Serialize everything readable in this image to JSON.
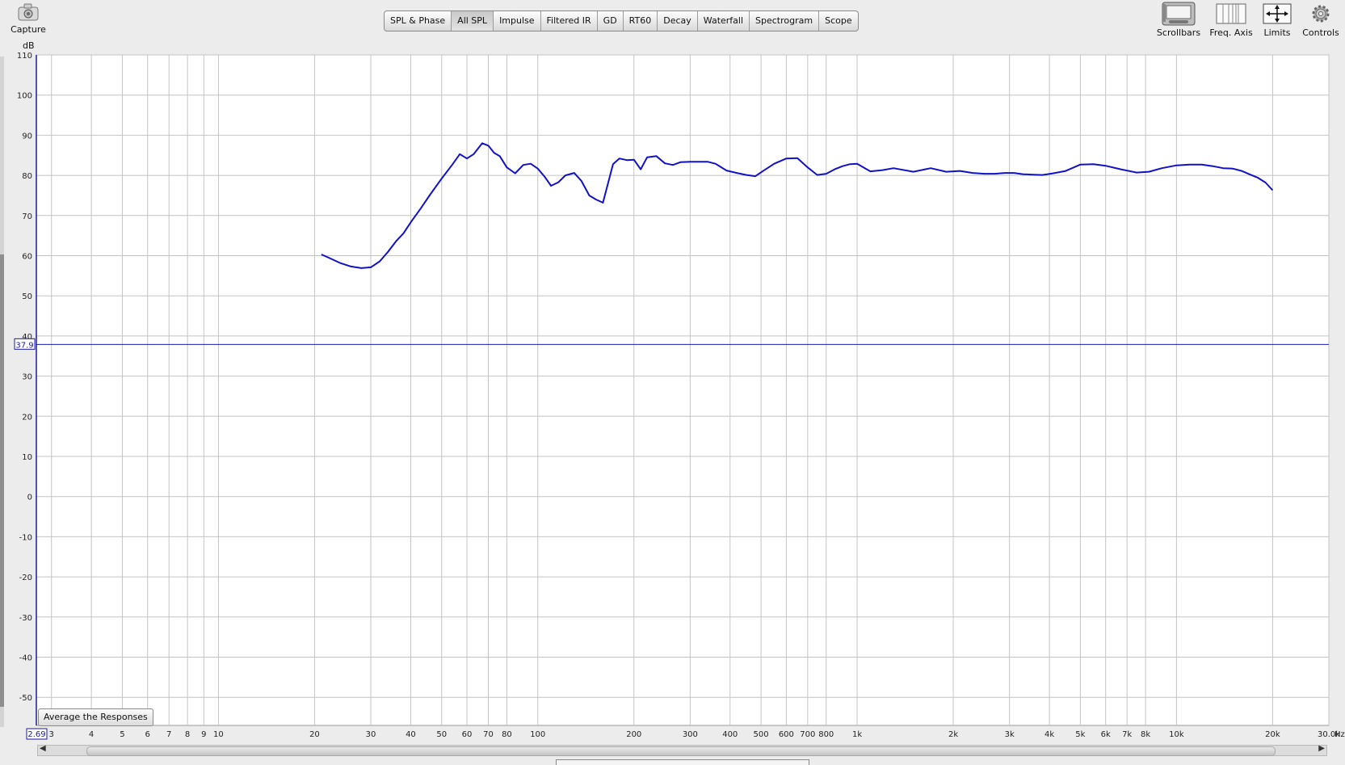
{
  "toolbar": {
    "capture_label": "Capture",
    "scrollbars_label": "Scrollbars",
    "freq_axis_label": "Freq. Axis",
    "limits_label": "Limits",
    "controls_label": "Controls"
  },
  "tabs": [
    {
      "label": "SPL & Phase",
      "active": false
    },
    {
      "label": "All SPL",
      "active": true
    },
    {
      "label": "Impulse",
      "active": false
    },
    {
      "label": "Filtered IR",
      "active": false
    },
    {
      "label": "GD",
      "active": false
    },
    {
      "label": "RT60",
      "active": false
    },
    {
      "label": "Decay",
      "active": false
    },
    {
      "label": "Waterfall",
      "active": false
    },
    {
      "label": "Spectrogram",
      "active": false
    },
    {
      "label": "Scope",
      "active": false
    }
  ],
  "y_unit": "dB",
  "x_unit": "Hz",
  "average_button_label": "Average the Responses",
  "colors": {
    "trace": "#1111c8",
    "cursor": "#1a1aa8",
    "grid": "#c4c4c4",
    "plot_bg": "#ffffff"
  },
  "chart_data": {
    "type": "line",
    "y_unit_label": "dB",
    "x_unit_label": "Hz",
    "xscale": "log",
    "xlim": [
      2.69,
      30000
    ],
    "ylim": [
      -57,
      110
    ],
    "grid": true,
    "y_ticks": [
      110,
      100,
      90,
      80,
      70,
      60,
      50,
      40,
      30,
      20,
      10,
      0,
      -10,
      -20,
      -30,
      -40,
      -50
    ],
    "x_ticks": [
      {
        "value": 3,
        "label": "3"
      },
      {
        "value": 4,
        "label": "4"
      },
      {
        "value": 5,
        "label": "5"
      },
      {
        "value": 6,
        "label": "6"
      },
      {
        "value": 7,
        "label": "7"
      },
      {
        "value": 8,
        "label": "8"
      },
      {
        "value": 9,
        "label": "9"
      },
      {
        "value": 10,
        "label": "10"
      },
      {
        "value": 20,
        "label": "20"
      },
      {
        "value": 30,
        "label": "30"
      },
      {
        "value": 40,
        "label": "40"
      },
      {
        "value": 50,
        "label": "50"
      },
      {
        "value": 60,
        "label": "60"
      },
      {
        "value": 70,
        "label": "70"
      },
      {
        "value": 80,
        "label": "80"
      },
      {
        "value": 100,
        "label": "100"
      },
      {
        "value": 200,
        "label": "200"
      },
      {
        "value": 300,
        "label": "300"
      },
      {
        "value": 400,
        "label": "400"
      },
      {
        "value": 500,
        "label": "500"
      },
      {
        "value": 600,
        "label": "600"
      },
      {
        "value": 700,
        "label": "700"
      },
      {
        "value": 800,
        "label": "800"
      },
      {
        "value": 1000,
        "label": "1k"
      },
      {
        "value": 2000,
        "label": "2k"
      },
      {
        "value": 3000,
        "label": "3k"
      },
      {
        "value": 4000,
        "label": "4k"
      },
      {
        "value": 5000,
        "label": "5k"
      },
      {
        "value": 6000,
        "label": "6k"
      },
      {
        "value": 7000,
        "label": "7k"
      },
      {
        "value": 8000,
        "label": "8k"
      },
      {
        "value": 10000,
        "label": "10k"
      },
      {
        "value": 20000,
        "label": "20k"
      },
      {
        "value": 30000,
        "label": "30.0k"
      }
    ],
    "cursor_y_value": 37.9,
    "cursor_y_label": "37.9",
    "x_start_label": "2.69",
    "series": [
      {
        "x": [
          21,
          22,
          24,
          26,
          28,
          30,
          32,
          34,
          36,
          38,
          40,
          43,
          46,
          50,
          54,
          57,
          60,
          63,
          67,
          70,
          73,
          76,
          80,
          85,
          90,
          95,
          100,
          105,
          110,
          116,
          122,
          130,
          137,
          145,
          152,
          160,
          166,
          172,
          180,
          190,
          200,
          210,
          220,
          235,
          250,
          265,
          280,
          300,
          320,
          340,
          360,
          390,
          420,
          450,
          480,
          510,
          550,
          600,
          650,
          700,
          750,
          800,
          850,
          900,
          950,
          1000,
          1100,
          1200,
          1300,
          1500,
          1700,
          1900,
          2100,
          2300,
          2500,
          2700,
          2900,
          3100,
          3300,
          3500,
          3800,
          4100,
          4500,
          5000,
          5500,
          6000,
          6700,
          7500,
          8200,
          9000,
          10000,
          11000,
          12000,
          13000,
          14000,
          15000,
          16000,
          17000,
          18000,
          19000,
          20000
        ],
        "y": [
          60.3,
          59.6,
          58.2,
          57.3,
          56.9,
          57.1,
          58.6,
          61.0,
          63.6,
          65.6,
          68.3,
          71.8,
          75.2,
          79.2,
          82.7,
          85.3,
          84.2,
          85.3,
          88.0,
          87.4,
          85.6,
          84.8,
          82.0,
          80.5,
          82.6,
          82.9,
          81.7,
          79.7,
          77.4,
          78.3,
          80.0,
          80.6,
          78.6,
          75.0,
          74.0,
          73.2,
          78.1,
          82.8,
          84.2,
          83.8,
          83.9,
          81.5,
          84.5,
          84.8,
          83.0,
          82.6,
          83.3,
          83.4,
          83.4,
          83.4,
          82.9,
          81.2,
          80.6,
          80.1,
          79.8,
          81.2,
          82.9,
          84.2,
          84.3,
          82.0,
          80.1,
          80.4,
          81.5,
          82.3,
          82.8,
          82.9,
          81.0,
          81.3,
          81.8,
          80.9,
          81.8,
          80.9,
          81.1,
          80.6,
          80.4,
          80.4,
          80.6,
          80.6,
          80.3,
          80.2,
          80.1,
          80.5,
          81.1,
          82.7,
          82.8,
          82.4,
          81.5,
          80.7,
          80.9,
          81.8,
          82.5,
          82.7,
          82.7,
          82.3,
          81.8,
          81.7,
          81.1,
          80.2,
          79.4,
          78.2,
          76.3
        ]
      }
    ]
  }
}
